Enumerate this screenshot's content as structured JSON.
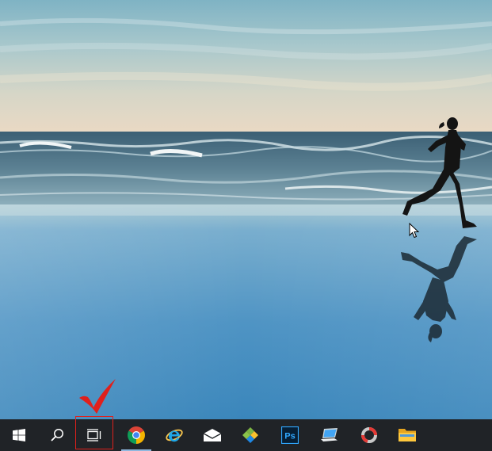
{
  "desktop": {
    "wallpaper": "beach-runner-silhouette-reflection",
    "colors": {
      "sky_top": "#8fbcc9",
      "sky_horizon": "#e6dccb",
      "sea": "#456f86",
      "wet_sand": "#5b9ac0",
      "sand_near": "#3d86ba"
    }
  },
  "taskbar": {
    "background": "#202327",
    "items": [
      {
        "name": "start",
        "icon": "windows-logo-icon",
        "running": false
      },
      {
        "name": "search",
        "icon": "search-icon",
        "running": false
      },
      {
        "name": "task-view",
        "icon": "task-view-icon",
        "running": false,
        "highlighted": true
      },
      {
        "name": "chrome",
        "icon": "chrome-icon",
        "running": true
      },
      {
        "name": "internet-explorer",
        "icon": "internet-explorer-icon",
        "running": false
      },
      {
        "name": "mail",
        "icon": "mail-icon",
        "running": false
      },
      {
        "name": "app",
        "icon": "diamond-app-icon",
        "running": false
      },
      {
        "name": "photoshop",
        "icon": "photoshop-icon",
        "label": "Ps",
        "running": false
      },
      {
        "name": "this-pc",
        "icon": "laptop-icon",
        "running": false
      },
      {
        "name": "app-ring",
        "icon": "ring-app-icon",
        "running": false
      },
      {
        "name": "file-explorer",
        "icon": "folder-icon",
        "running": false
      }
    ]
  },
  "annotation": {
    "color": "#e0201c",
    "target": "task-view",
    "marks": [
      "highlight-box",
      "checkmark"
    ]
  }
}
